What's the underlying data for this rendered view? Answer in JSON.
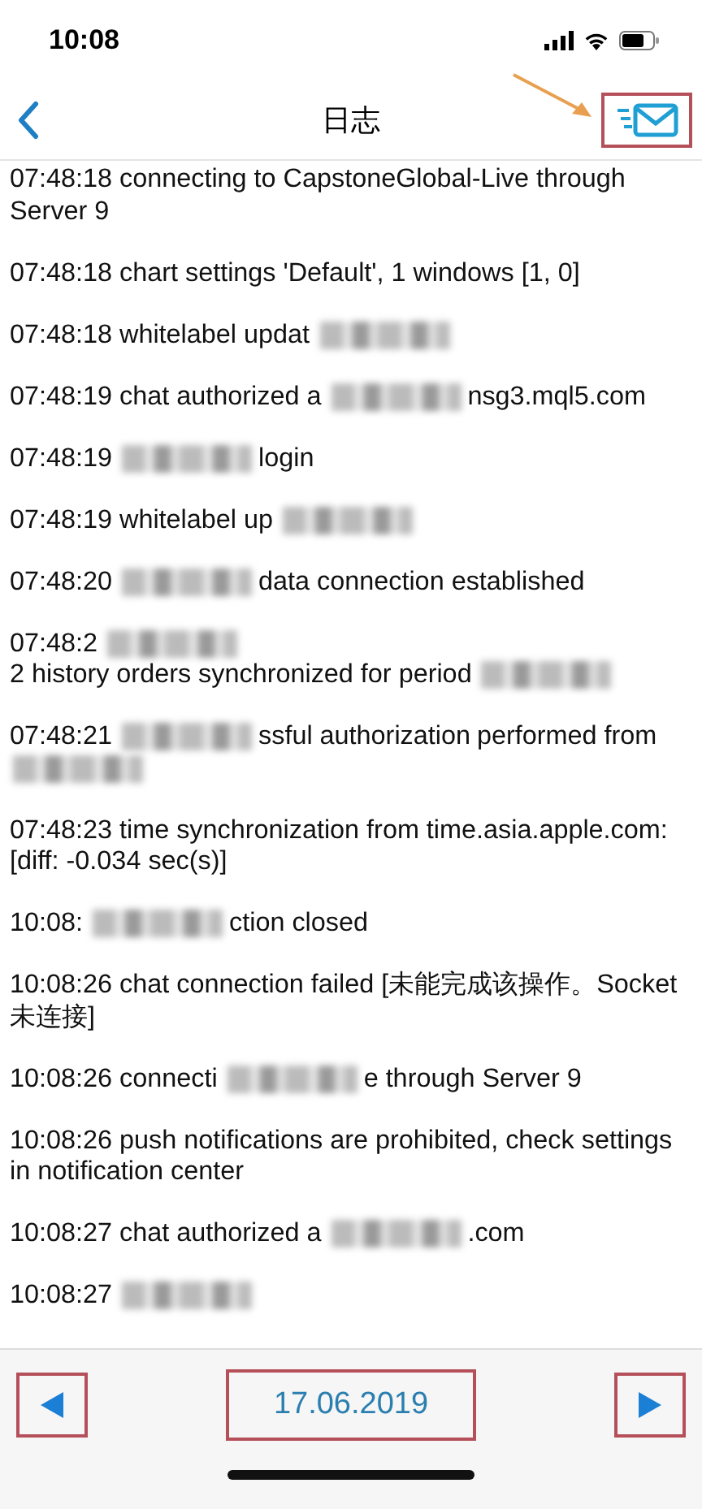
{
  "status_bar": {
    "time": "10:08"
  },
  "nav_bar": {
    "title": "日志",
    "mail_button": {
      "highlighted": true
    }
  },
  "log": [
    {
      "parts": [
        {
          "kind": "text",
          "text": "07:48:18 connecting to CapstoneGlobal-Live through Server 9"
        }
      ]
    },
    {
      "parts": [
        {
          "kind": "text",
          "text": "07:48:18 chart settings 'Default', 1 windows [1, 0]"
        }
      ]
    },
    {
      "parts": [
        {
          "kind": "text",
          "text": "07:48:18 whitelabel updat"
        },
        {
          "kind": "redacted"
        }
      ]
    },
    {
      "parts": [
        {
          "kind": "text",
          "text": "07:48:19 chat authorized a"
        },
        {
          "kind": "redacted"
        },
        {
          "kind": "text",
          "text": "nsg3.mql5.com"
        }
      ]
    },
    {
      "parts": [
        {
          "kind": "text",
          "text": "07:48:19"
        },
        {
          "kind": "redacted"
        },
        {
          "kind": "text",
          "text": "login"
        }
      ]
    },
    {
      "parts": [
        {
          "kind": "text",
          "text": "07:48:19 whitelabel up"
        },
        {
          "kind": "redacted"
        }
      ]
    },
    {
      "parts": [
        {
          "kind": "text",
          "text": "07:48:20"
        },
        {
          "kind": "redacted"
        },
        {
          "kind": "text",
          "text": "data connection established"
        }
      ]
    },
    {
      "parts": [
        {
          "kind": "text",
          "text": "07:48:2"
        },
        {
          "kind": "redacted"
        },
        {
          "kind": "text",
          "text": "2 history orders synchronized for period"
        },
        {
          "kind": "redacted"
        }
      ]
    },
    {
      "parts": [
        {
          "kind": "text",
          "text": "07:48:21"
        },
        {
          "kind": "redacted"
        },
        {
          "kind": "text",
          "text": "ssful authorization"
        },
        {
          "kind": "text",
          "text": "performed from"
        },
        {
          "kind": "redacted"
        }
      ]
    },
    {
      "parts": [
        {
          "kind": "text",
          "text": "07:48:23 time synchronization from time.asia.apple.com: [diff: -0.034 sec(s)]"
        }
      ]
    },
    {
      "parts": [
        {
          "kind": "text",
          "text": "10:08:"
        },
        {
          "kind": "redacted"
        },
        {
          "kind": "text",
          "text": "ction closed"
        }
      ]
    },
    {
      "parts": [
        {
          "kind": "text",
          "text": "10:08:26 chat connection failed [未能完成该操作。Socket 未连接]"
        }
      ]
    },
    {
      "parts": [
        {
          "kind": "text",
          "text": "10:08:26 connecti"
        },
        {
          "kind": "redacted"
        },
        {
          "kind": "text",
          "text": "e through Server 9"
        }
      ]
    },
    {
      "parts": [
        {
          "kind": "text",
          "text": "10:08:26 push notifications are prohibited, check settings in notification center"
        }
      ]
    },
    {
      "parts": [
        {
          "kind": "text",
          "text": "10:08:27 chat authorized a"
        },
        {
          "kind": "redacted"
        },
        {
          "kind": "text",
          "text": ".com"
        }
      ]
    },
    {
      "parts": [
        {
          "kind": "text",
          "text": "10:08:27"
        },
        {
          "kind": "redacted"
        }
      ]
    }
  ],
  "toolbar": {
    "prev_button": {
      "highlighted": true
    },
    "date": {
      "text": "17.06.2019",
      "highlighted": true
    },
    "next_button": {
      "highlighted": true
    }
  }
}
